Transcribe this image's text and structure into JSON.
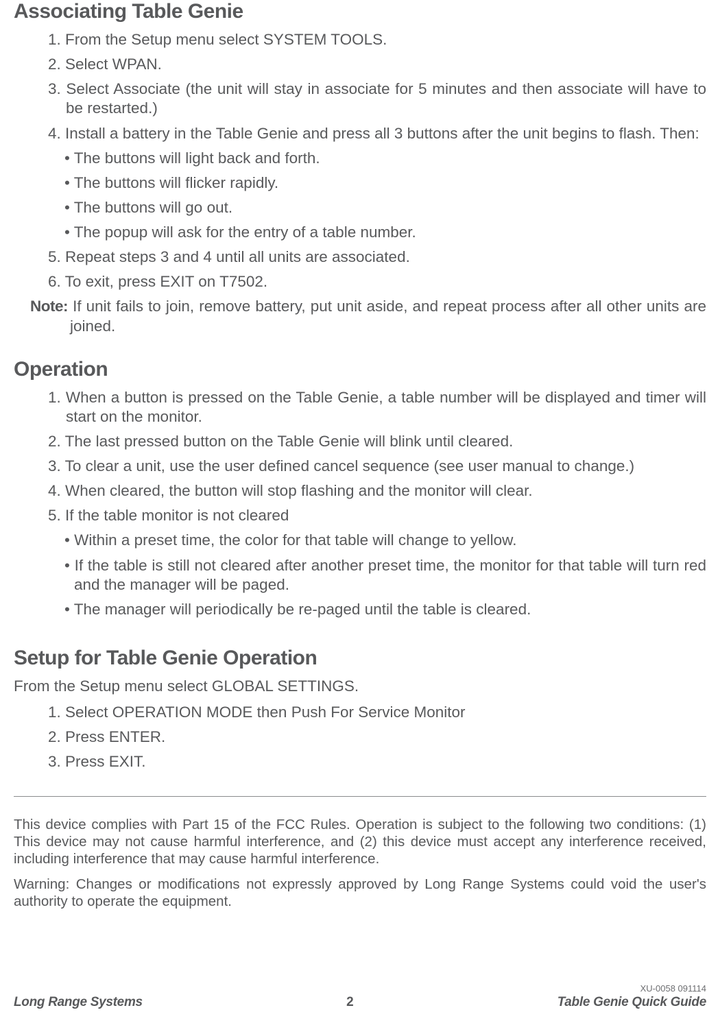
{
  "sections": {
    "s1": {
      "heading": "Associating Table Genie",
      "items": {
        "i1": "1. From the Setup menu select SYSTEM TOOLS.",
        "i2": "2. Select WPAN.",
        "i3": "3. Select Associate (the unit will stay in associate for 5 minutes and then associate will have to be restarted.)",
        "i4": "4. Install a battery in the Table Genie and press all 3 buttons after the unit begins to flash.  Then:",
        "i4a": "• The buttons will light back and forth.",
        "i4b": "• The buttons will flicker rapidly.",
        "i4c": "• The buttons will go out.",
        "i4d": "• The popup will ask for the entry of a table number.",
        "i5": "5. Repeat steps 3 and 4 until all units are associated.",
        "i6": "6. To exit, press EXIT on T7502."
      },
      "note_label": "Note:",
      "note_text": " If unit fails to join, remove battery, put unit aside, and repeat process after all other units are joined."
    },
    "s2": {
      "heading": "Operation",
      "items": {
        "i1": "1. When a button is pressed on the Table Genie, a table number will be displayed and timer will start on the monitor.",
        "i2": "2. The last pressed button on the Table Genie will blink until cleared.",
        "i3": "3. To clear a unit, use the user defined cancel sequence (see user manual to change.)",
        "i4": "4. When cleared, the button will stop flashing and the monitor will clear.",
        "i5": "5. If the table monitor is not cleared",
        "i5a": "• Within a preset time, the color for that table will change to yellow.",
        "i5b": "• If the table is still not cleared after another preset time, the monitor for that table will turn red and the manager will be paged.",
        "i5c": "• The manager will periodically be re-paged until the table is cleared."
      }
    },
    "s3": {
      "heading": "Setup for Table Genie Operation",
      "intro": "From the Setup menu select GLOBAL SETTINGS.",
      "items": {
        "i1": "1. Select OPERATION MODE then Push For Service Monitor",
        "i2": "2. Press ENTER.",
        "i3": "3. Press EXIT."
      }
    }
  },
  "fcc": {
    "p1": "This device complies with Part 15 of the FCC Rules. Operation is subject to the following two conditions: (1) This device may not cause harmful interference, and (2) this device must accept any interference received, including interference that may cause harmful interference.",
    "p2": "Warning: Changes or modifications not expressly approved by Long Range Systems could void the user's authority to operate the equipment."
  },
  "docid": "XU-0058 091114",
  "footer": {
    "left": "Long Range Systems",
    "center": "2",
    "right": "Table Genie Quick Guide"
  }
}
